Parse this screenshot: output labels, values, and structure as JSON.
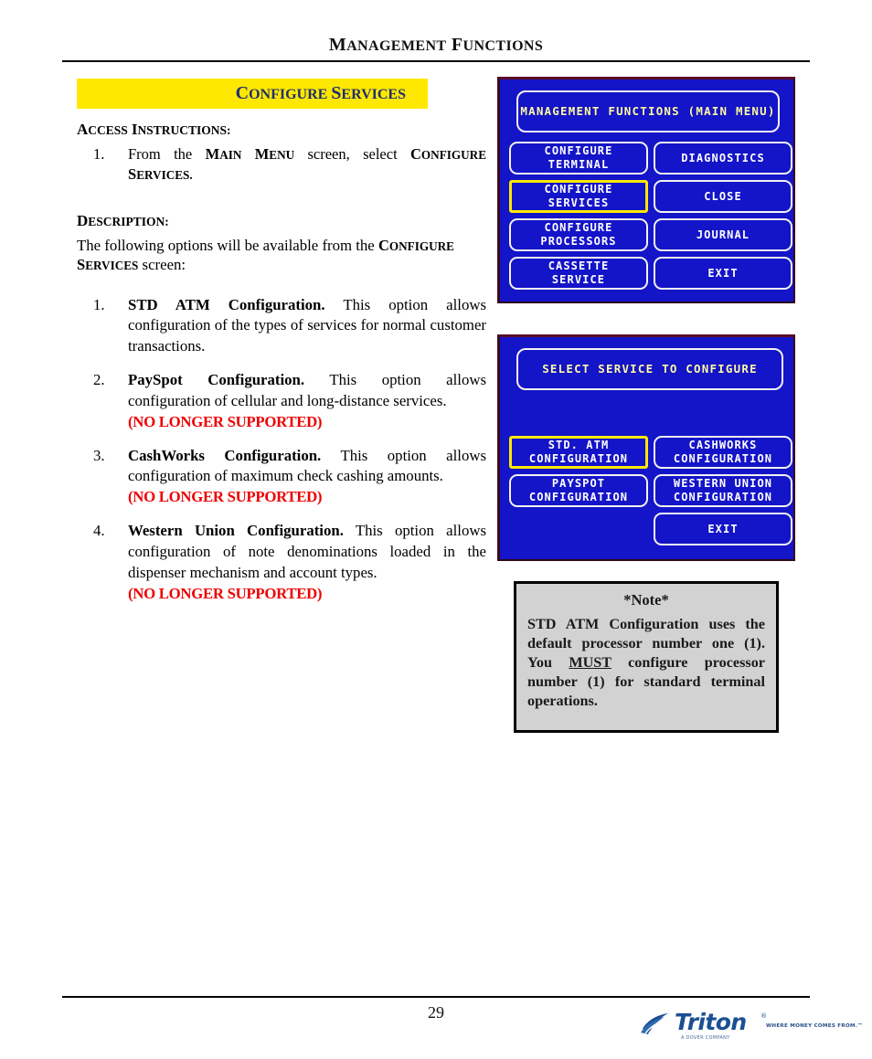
{
  "page": {
    "header_title": "MANAGEMENT FUNCTIONS",
    "section_banner": "CONFIGURE SERVICES",
    "page_number": "29"
  },
  "left_column": {
    "access_heading": "ACCESS INSTRUCTIONS:",
    "access_steps": [
      {
        "num": "1.",
        "pre": "From the ",
        "sc1": "MAIN MENU",
        "mid": " screen, select ",
        "sc2": "CONFIGURE SERVICES.",
        "post": ""
      }
    ],
    "description_heading": "DESCRIPTION:",
    "description_pre": "The following options will be available from the ",
    "description_sc": "CONFIGURE SERVICES",
    "description_post": " screen:",
    "options": [
      {
        "num": "1.",
        "title": "STD ATM Configuration.",
        "text": " This option allows configuration of the types of services for normal customer transactions.",
        "note": ""
      },
      {
        "num": "2.",
        "title": "PaySpot Configuration.",
        "text": "  This option allows configuration of cellular and long-distance services.",
        "note": "(NO LONGER SUPPORTED)"
      },
      {
        "num": "3.",
        "title": "CashWorks Configuration.",
        "text": " This option allows configuration of maximum check cashing amounts.",
        "note": "(NO LONGER SUPPORTED)"
      },
      {
        "num": "4.",
        "title": "Western Union Configuration.",
        "text": " This option allows configuration of  note denominations loaded in the dispenser mechanism and account types.",
        "note": "(NO LONGER SUPPORTED)"
      }
    ]
  },
  "atm_screen_main": {
    "title": "MANAGEMENT FUNCTIONS\n(MAIN MENU)",
    "buttons": {
      "configure_terminal": "CONFIGURE\nTERMINAL",
      "configure_services": "CONFIGURE\nSERVICES",
      "configure_processors": "CONFIGURE\nPROCESSORS",
      "cassette_service": "CASSETTE\nSERVICE",
      "diagnostics": "DIAGNOSTICS",
      "close": "CLOSE",
      "journal": "JOURNAL",
      "exit": "EXIT"
    },
    "selected_button": "configure_services"
  },
  "atm_screen_services": {
    "title": "SELECT SERVICE TO CONFIGURE",
    "buttons": {
      "std_atm": "STD. ATM\nCONFIGURATION",
      "payspot": "PAYSPOT\nCONFIGURATION",
      "cashworks": "CASHWORKS\nCONFIGURATION",
      "western_union": "WESTERN UNION\nCONFIGURATION",
      "exit": "EXIT"
    },
    "selected_button": "std_atm"
  },
  "note_box": {
    "title": "*Note*",
    "pre": "STD ATM Configuration uses the default processor number one (1). You ",
    "emphasis": "MUST",
    "post": " configure processor number (1) for standard terminal operations."
  },
  "footer": {
    "logo_wordmark": "Triton",
    "logo_tm": "®",
    "logo_tagline": "WHERE MONEY COMES FROM.™",
    "logo_sub": "A DOVER COMPANY"
  },
  "colors": {
    "banner_yellow": "#ffe800",
    "banner_text_navy": "#1f2f70",
    "screen_blue": "#1414c8",
    "screen_title_yellow": "#fdf8b0",
    "highlight_yellow": "#ffe800",
    "unsupported_red": "#ee0000",
    "note_gray": "#d2d2d2",
    "triton_blue": "#1b4f93"
  }
}
